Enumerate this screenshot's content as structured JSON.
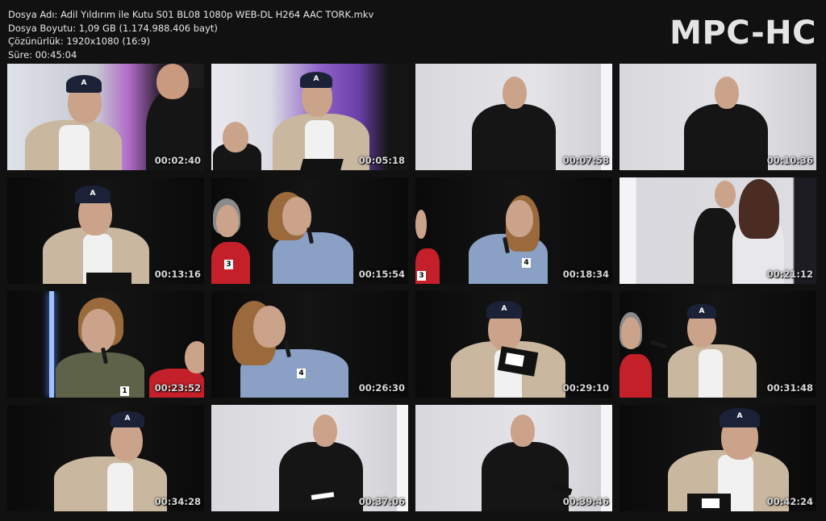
{
  "header": {
    "file_name": "Dosya Adı: Adil Yıldırım ile Kutu S01 BL08 1080p WEB-DL H264 AAC TORK.mkv",
    "file_size": "Dosya Boyutu: 1,09 GB (1.174.988.406 bayt)",
    "resolution": "Çözünürlük: 1920x1080 (16:9)",
    "duration": "Süre: 00:45:04"
  },
  "logo": "MPC-HC",
  "thumbnails": [
    {
      "time": "00:02:40"
    },
    {
      "time": "00:05:18"
    },
    {
      "time": "00:07:58"
    },
    {
      "time": "00:10:36"
    },
    {
      "time": "00:13:16"
    },
    {
      "time": "00:15:54"
    },
    {
      "time": "00:18:34"
    },
    {
      "time": "00:21:12"
    },
    {
      "time": "00:23:52"
    },
    {
      "time": "00:26:30"
    },
    {
      "time": "00:29:10"
    },
    {
      "time": "00:31:48"
    },
    {
      "time": "00:34:28"
    },
    {
      "time": "00:37:06"
    },
    {
      "time": "00:39:46"
    },
    {
      "time": "00:42:24"
    }
  ],
  "badges": {
    "one": "1",
    "three": "3",
    "four": "4"
  }
}
